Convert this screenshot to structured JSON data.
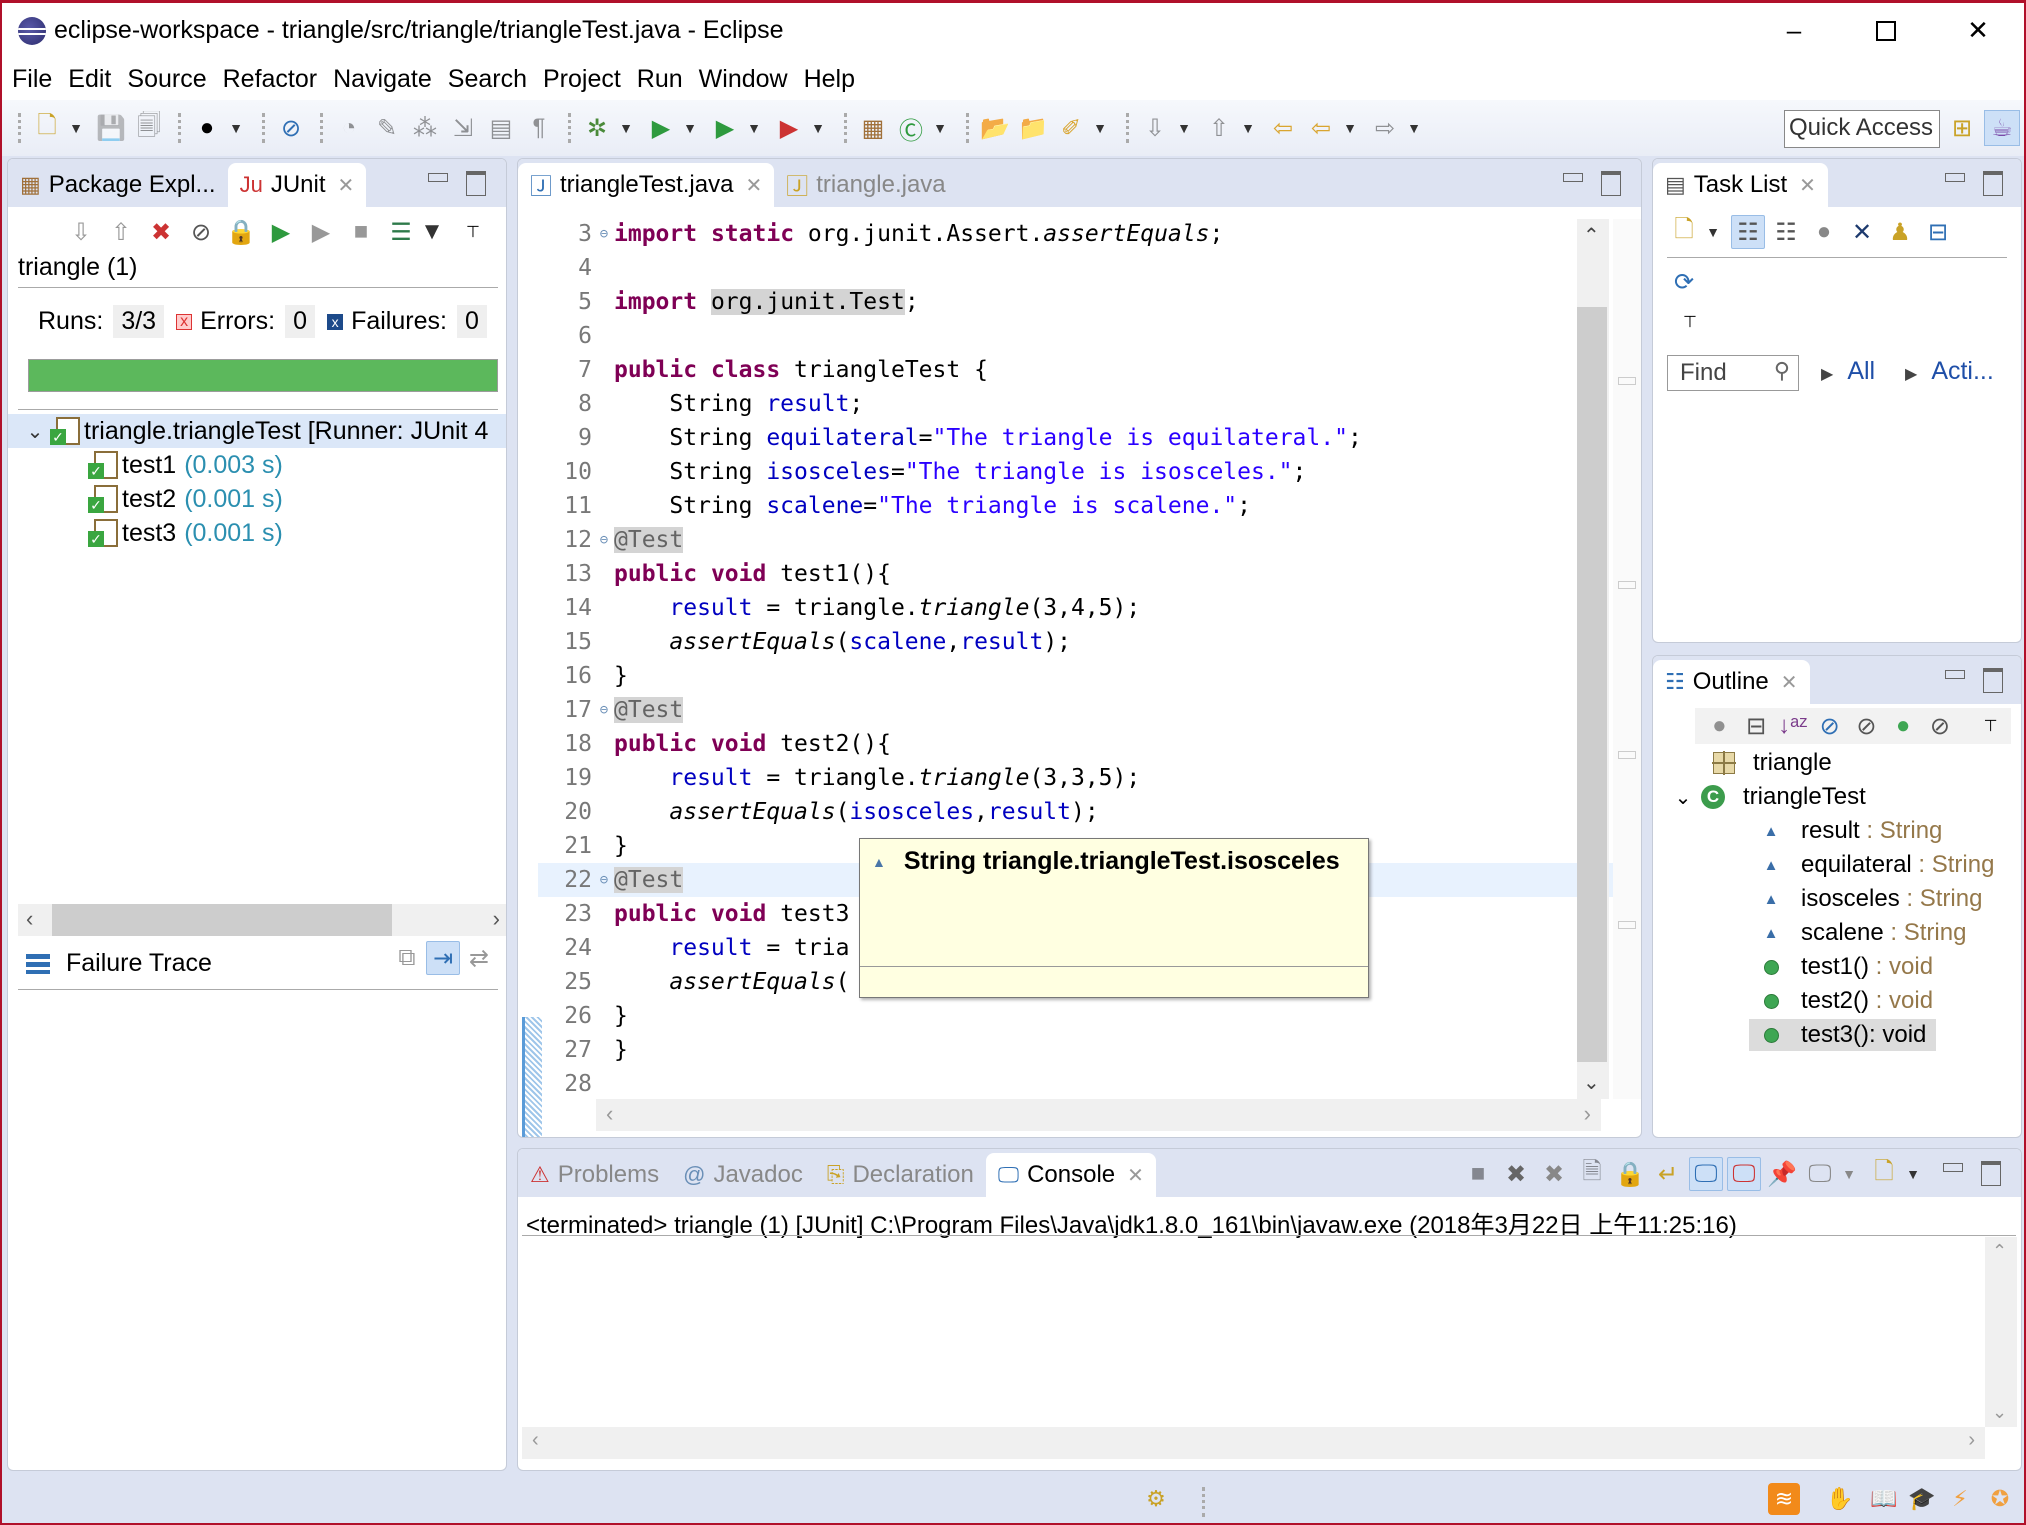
{
  "window": {
    "title": "eclipse-workspace - triangle/src/triangle/triangleTest.java - Eclipse",
    "minimize": "–",
    "close": "✕"
  },
  "menu": [
    "File",
    "Edit",
    "Source",
    "Refactor",
    "Navigate",
    "Search",
    "Project",
    "Run",
    "Window",
    "Help"
  ],
  "toolbar": {
    "quick_access": "Quick Access"
  },
  "left_panel": {
    "tabs": [
      {
        "label": "Package Expl...",
        "active": false
      },
      {
        "label": "JUnit",
        "active": true
      }
    ],
    "project": "triangle (1)",
    "runs_label": "Runs:",
    "runs_value": "3/3",
    "errors_label": "Errors:",
    "errors_value": "0",
    "failures_label": "Failures:",
    "failures_value": "0",
    "progress_fraction": 1.0,
    "progress_color": "#5cb85c",
    "tree": {
      "root": "triangle.triangleTest [Runner: JUnit 4",
      "tests": [
        {
          "name": "test1",
          "time": "(0.003 s)"
        },
        {
          "name": "test2",
          "time": "(0.001 s)"
        },
        {
          "name": "test3",
          "time": "(0.001 s)"
        }
      ]
    },
    "failure_trace": "Failure Trace"
  },
  "editor": {
    "tabs": [
      {
        "label": "triangleTest.java",
        "active": true
      },
      {
        "label": "triangle.java",
        "active": false
      }
    ],
    "lines": [
      {
        "n": "3",
        "fold": true
      },
      {
        "n": "4"
      },
      {
        "n": "5"
      },
      {
        "n": "6"
      },
      {
        "n": "7"
      },
      {
        "n": "8"
      },
      {
        "n": "9"
      },
      {
        "n": "10"
      },
      {
        "n": "11"
      },
      {
        "n": "12",
        "fold": true
      },
      {
        "n": "13"
      },
      {
        "n": "14"
      },
      {
        "n": "15"
      },
      {
        "n": "16"
      },
      {
        "n": "17",
        "fold": true
      },
      {
        "n": "18"
      },
      {
        "n": "19"
      },
      {
        "n": "20"
      },
      {
        "n": "21"
      },
      {
        "n": "22",
        "fold": true
      },
      {
        "n": "23"
      },
      {
        "n": "24"
      },
      {
        "n": "25"
      },
      {
        "n": "26"
      },
      {
        "n": "27"
      },
      {
        "n": "28"
      }
    ],
    "code": {
      "l3": {
        "kw1": "import",
        "kw2": "static",
        "pkg": " org.junit.Assert.",
        "method": "assertEquals",
        "end": ";"
      },
      "l5": {
        "kw": "import",
        "pkg": "org.junit.Test",
        "end": ";"
      },
      "l7": {
        "kw1": "public",
        "kw2": "class",
        "rest": " triangleTest {"
      },
      "l8": {
        "type": "    String ",
        "field": "result",
        "end": ";"
      },
      "l9": {
        "type": "    String ",
        "field": "equilateral",
        "eq": "=",
        "str": "\"The triangle is equilateral.\"",
        "end": ";"
      },
      "l10": {
        "type": "    String ",
        "field": "isosceles",
        "eq": "=",
        "str": "\"The triangle is isosceles.\"",
        "end": ";"
      },
      "l11": {
        "type": "    String ",
        "field": "scalene",
        "eq": "=",
        "str": "\"The triangle is scalene.\"",
        "end": ";"
      },
      "ann": "@Test",
      "l13": {
        "kw1": "public",
        "kw2": "void",
        "rest": " test1(){"
      },
      "l14": {
        "indent": "    ",
        "field": "result",
        "mid": " = triangle.",
        "method": "triangle",
        "args": "(3,4,5);"
      },
      "l15": {
        "indent": "    ",
        "method": "assertEquals",
        "open": "(",
        "f1": "scalene",
        "comma": ",",
        "f2": "result",
        "close": ");"
      },
      "brace": "}",
      "l18": {
        "kw1": "public",
        "kw2": "void",
        "rest": " test2(){"
      },
      "l19": {
        "indent": "    ",
        "field": "result",
        "mid": " = triangle.",
        "method": "triangle",
        "args": "(3,3,5);"
      },
      "l20": {
        "indent": "    ",
        "method": "assertEquals",
        "open": "(",
        "f1": "isosceles",
        "comma": ",",
        "f2": "result",
        "close": ");"
      },
      "l23": {
        "kw1": "public",
        "kw2": "void",
        "rest": " test3"
      },
      "l24": {
        "indent": "    ",
        "field": "result",
        "mid": " = tria"
      },
      "l25": {
        "indent": "    ",
        "method": "assertEquals",
        "open": "("
      }
    },
    "tooltip": "String triangle.triangleTest.isosceles"
  },
  "task_list": {
    "tab": "Task List",
    "find_placeholder": "Find",
    "link_all": "All",
    "link_activate": "Acti..."
  },
  "outline": {
    "tab": "Outline",
    "package": "triangle",
    "class": "triangleTest",
    "members": [
      {
        "name": "result",
        "type": " : String",
        "kind": "field"
      },
      {
        "name": "equilateral",
        "type": " : String",
        "kind": "field"
      },
      {
        "name": "isosceles",
        "type": " : String",
        "kind": "field"
      },
      {
        "name": "scalene",
        "type": " : String",
        "kind": "field"
      },
      {
        "name": "test1()",
        "type": " : void",
        "kind": "method"
      },
      {
        "name": "test2()",
        "type": " : void",
        "kind": "method"
      },
      {
        "name": "test3()",
        "type": " : void",
        "kind": "method",
        "selected": true
      }
    ]
  },
  "bottom_panel": {
    "tabs": [
      {
        "label": "Problems",
        "active": false
      },
      {
        "label": "Javadoc",
        "active": false
      },
      {
        "label": "Declaration",
        "active": false
      },
      {
        "label": "Console",
        "active": true
      }
    ],
    "console_header": "<terminated> triangle (1) [JUnit] C:\\Program Files\\Java\\jdk1.8.0_161\\bin\\javaw.exe (2018年3月22日 上午11:25:16)"
  }
}
